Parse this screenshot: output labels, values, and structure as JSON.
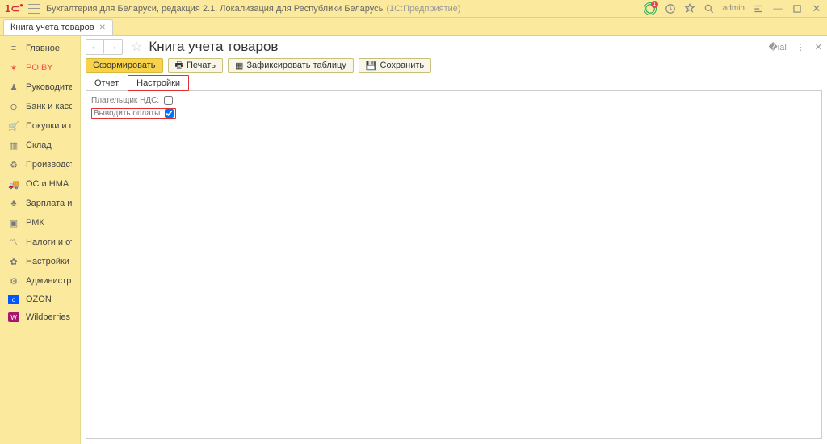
{
  "app": {
    "title": "Бухгалтерия для Беларуси, редакция 2.1. Локализация для Республики Беларусь",
    "suffix": "(1С:Предприятие)",
    "user": "admin",
    "notification_count": "1"
  },
  "tabs": {
    "active": "Книга учета товаров"
  },
  "sidebar": {
    "items": [
      {
        "icon": "home",
        "label": "Главное"
      },
      {
        "icon": "star",
        "label": "PO BY"
      },
      {
        "icon": "person",
        "label": "Руководителю"
      },
      {
        "icon": "piggy",
        "label": "Банк и касса"
      },
      {
        "icon": "cart",
        "label": "Покупки и продажи"
      },
      {
        "icon": "box",
        "label": "Склад"
      },
      {
        "icon": "factory",
        "label": "Производство"
      },
      {
        "icon": "truck",
        "label": "ОС и НМА"
      },
      {
        "icon": "people",
        "label": "Зарплата и кадры"
      },
      {
        "icon": "rmk",
        "label": "РМК"
      },
      {
        "icon": "chart",
        "label": "Налоги и отчетность"
      },
      {
        "icon": "gear",
        "label": "Настройки учета"
      },
      {
        "icon": "cog",
        "label": "Администрирование"
      },
      {
        "icon": "ozon",
        "label": "OZON"
      },
      {
        "icon": "wb",
        "label": "Wildberries"
      }
    ]
  },
  "page": {
    "title": "Книга учета товаров",
    "toolbar": {
      "generate": "Сформировать",
      "print": "Печать",
      "fix_table": "Зафиксировать таблицу",
      "save": "Сохранить"
    },
    "subtabs": {
      "report": "Отчет",
      "settings": "Настройки"
    },
    "settings": {
      "vat_payer_label": "Плательщик НДС:",
      "vat_payer_checked": false,
      "show_payments_label": "Выводить оплаты",
      "show_payments_checked": true
    }
  }
}
